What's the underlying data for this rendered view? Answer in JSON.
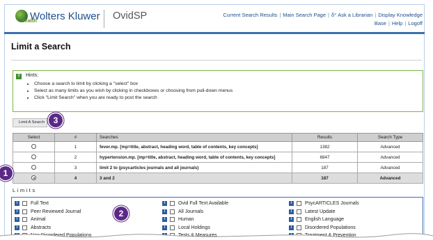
{
  "header": {
    "brand": "Wolters Kluwer",
    "brand_sub": "Health",
    "product": "OvidSP",
    "links_row1": [
      "Current Search Results",
      "Main Search Page",
      "Ask a Librarian",
      "Display Knowledge"
    ],
    "links_row2": [
      "Base",
      "Help",
      "Logoff"
    ]
  },
  "page": {
    "title": "Limit a Search"
  },
  "hints": {
    "icon": "?",
    "title": "Hints:",
    "items": [
      "Choose a search to limit by clicking a \"select\" box",
      "Select as many limits as you wish by clicking in checkboxes or choosing from pull-down menus",
      "Click \"Limit Search\" when you are ready to post the search"
    ]
  },
  "limit_button": {
    "label": "Limit A Search"
  },
  "table": {
    "headers": [
      "Select",
      "#",
      "Searches",
      "Results",
      "Search Type"
    ],
    "rows": [
      {
        "num": "1",
        "search": "fever.mp. [mp=title, abstract, heading word, table of contents, key concepts]",
        "results": "1382",
        "type": "Advanced",
        "selected": false
      },
      {
        "num": "2",
        "search": "hypertension.mp. [mp=title, abstract, heading word, table of contents, key concepts]",
        "results": "6847",
        "type": "Advanced",
        "selected": false
      },
      {
        "num": "3",
        "search": "limit 2 to (psycarticles journals and all journals)",
        "results": "187",
        "type": "Advanced",
        "selected": false
      },
      {
        "num": "4",
        "search": "3 and 2",
        "results": "187",
        "type": "Advanced",
        "selected": true
      }
    ]
  },
  "limits": {
    "label": "Limits",
    "col1": [
      "Full Text",
      "Peer Reviewed Journal",
      "Animal",
      "Abstracts",
      "Non Disordered Populations"
    ],
    "col2": [
      "Ovid Full Text Available",
      "All Journals",
      "Human",
      "Local Holdings",
      "Tests & Measures"
    ],
    "col3": [
      "PsycARTICLES Journals",
      "Latest Update",
      "English Language",
      "Disordered Populations",
      "Treatment & Prevention"
    ]
  },
  "callouts": [
    "1",
    "2",
    "3"
  ],
  "colors": {
    "accent": "#3b6fb0",
    "hint_border": "#7db544",
    "callout": "#5b2a86",
    "link": "#1d4e89"
  }
}
